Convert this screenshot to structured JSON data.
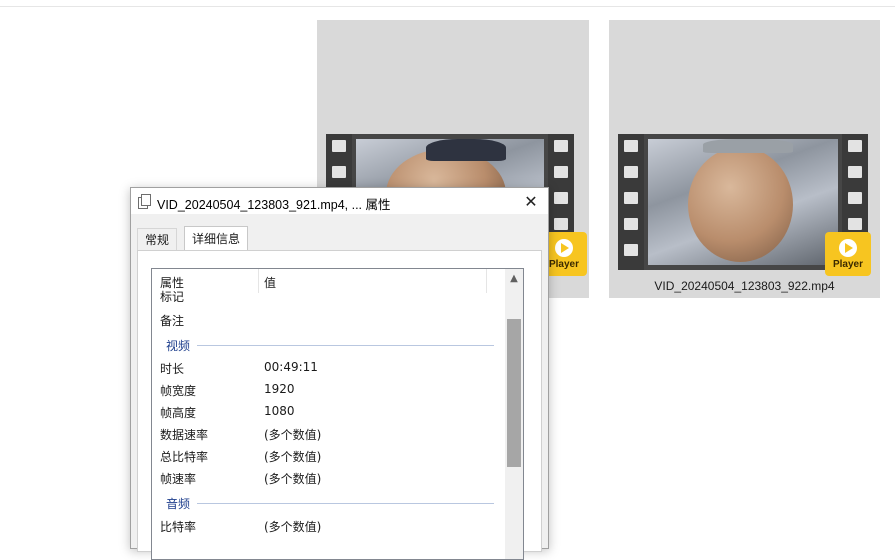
{
  "explorer": {
    "tiles": [
      {
        "filename": "",
        "player_label": "Player"
      },
      {
        "filename": "VID_20240504_123803_922.mp4",
        "player_label": "Player"
      }
    ]
  },
  "dialog": {
    "title": "VID_20240504_123803_921.mp4, ... 属性",
    "close_glyph": "✕",
    "tabs": [
      {
        "label": "常规",
        "active": false
      },
      {
        "label": "详细信息",
        "active": true
      }
    ],
    "columns": {
      "property": "属性",
      "value": "值"
    },
    "rows_top": [
      {
        "key": "标记",
        "value": ""
      },
      {
        "key": "备注",
        "value": ""
      }
    ],
    "group_video": "视频",
    "rows_video": [
      {
        "key": "时长",
        "value": "00:49:11"
      },
      {
        "key": "帧宽度",
        "value": "1920"
      },
      {
        "key": "帧高度",
        "value": "1080"
      },
      {
        "key": "数据速率",
        "value": "(多个数值)"
      },
      {
        "key": "总比特率",
        "value": "(多个数值)"
      },
      {
        "key": "帧速率",
        "value": "(多个数值)"
      }
    ],
    "group_audio": "音频",
    "rows_audio": [
      {
        "key": "比特率",
        "value": "(多个数值)"
      }
    ],
    "scroll_up_glyph": "▲"
  },
  "colors": {
    "tile_bg": "#d9d9d9",
    "player_badge": "#f7c520",
    "group_label": "#1c3d8c"
  },
  "icons": [
    "file-properties-icon",
    "close-icon",
    "play-icon",
    "scroll-up-arrow-icon"
  ]
}
